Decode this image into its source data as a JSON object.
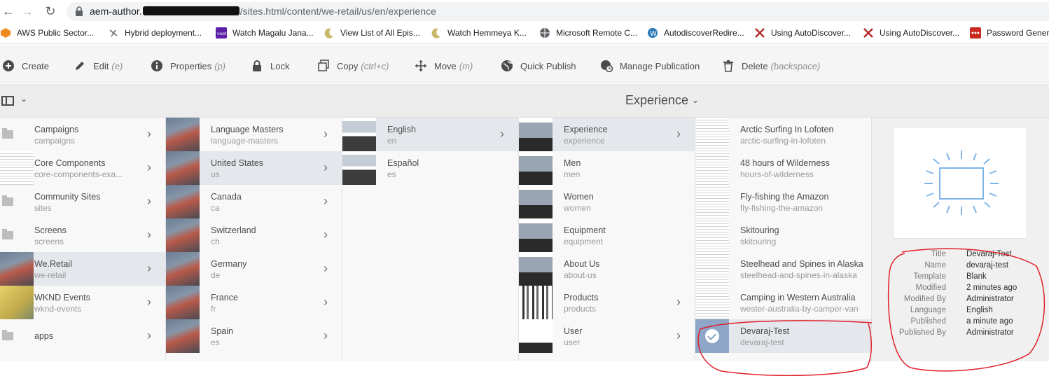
{
  "browser": {
    "url_host": "aem-author.",
    "url_path": "/sites.html/content/we-retail/us/en/experience",
    "bookmarks": [
      {
        "label": "AWS Public Sector...",
        "icon": "aws-icon"
      },
      {
        "label": "Hybrid deployment...",
        "icon": "page-icon"
      },
      {
        "label": "Watch Magalu Jana...",
        "icon": "voot-icon"
      },
      {
        "label": "View List of All Epis...",
        "icon": "moon-icon"
      },
      {
        "label": "Watch Hemmeya K...",
        "icon": "moon-icon"
      },
      {
        "label": "Microsoft Remote C...",
        "icon": "globe-icon"
      },
      {
        "label": "AutodiscoverRedire...",
        "icon": "wordpress-icon"
      },
      {
        "label": "Using AutoDiscover...",
        "icon": "x-logo-icon"
      },
      {
        "label": "Using AutoDiscover...",
        "icon": "x-logo-icon"
      },
      {
        "label": "Password Genera",
        "icon": "dots-icon"
      }
    ]
  },
  "actions": {
    "create": "Create",
    "edit": "Edit",
    "edit_sc": "(e)",
    "properties": "Properties",
    "properties_sc": "(p)",
    "lock": "Lock",
    "copy": "Copy",
    "copy_sc": "(ctrl+c)",
    "move": "Move",
    "move_sc": "(m)",
    "quick_publish": "Quick Publish",
    "manage_publication": "Manage Publication",
    "delete": "Delete",
    "delete_sc": "(backspace)"
  },
  "title": "Experience",
  "columns": [
    {
      "items": [
        {
          "label": "Campaigns",
          "name": "campaigns",
          "thumb": "folder",
          "chevron": true
        },
        {
          "label": "Core Components",
          "name": "core-components-exa...",
          "thumb": "page",
          "chevron": true
        },
        {
          "label": "Community Sites",
          "name": "sites",
          "thumb": "folder",
          "chevron": true
        },
        {
          "label": "Screens",
          "name": "screens",
          "thumb": "folder",
          "chevron": true
        },
        {
          "label": "We.Retail",
          "name": "we-retail",
          "thumb": "rock",
          "chevron": true,
          "selected": true
        },
        {
          "label": "WKND Events",
          "name": "wknd-events",
          "thumb": "yellow",
          "chevron": true
        },
        {
          "label": "apps",
          "name": "",
          "thumb": "folder",
          "chevron": true
        }
      ]
    },
    {
      "items": [
        {
          "label": "Language Masters",
          "name": "language-masters",
          "thumb": "rock",
          "chevron": true
        },
        {
          "label": "United States",
          "name": "us",
          "thumb": "rock",
          "chevron": true,
          "selected": true
        },
        {
          "label": "Canada",
          "name": "ca",
          "thumb": "rock",
          "chevron": true
        },
        {
          "label": "Switzerland",
          "name": "ch",
          "thumb": "rock",
          "chevron": true
        },
        {
          "label": "Germany",
          "name": "de",
          "thumb": "rock",
          "chevron": true
        },
        {
          "label": "France",
          "name": "fr",
          "thumb": "rock",
          "chevron": true
        },
        {
          "label": "Spain",
          "name": "es",
          "thumb": "rock",
          "chevron": true
        }
      ]
    },
    {
      "items": [
        {
          "label": "English",
          "name": "en",
          "thumb": "site",
          "chevron": true,
          "selected": true
        },
        {
          "label": "Español",
          "name": "es",
          "thumb": "site",
          "chevron": false
        }
      ]
    },
    {
      "items": [
        {
          "label": "Experience",
          "name": "experience",
          "thumb": "dark",
          "chevron": true,
          "selected": true
        },
        {
          "label": "Men",
          "name": "men",
          "thumb": "dark",
          "chevron": false
        },
        {
          "label": "Women",
          "name": "women",
          "thumb": "dark",
          "chevron": false
        },
        {
          "label": "Equipment",
          "name": "equipment",
          "thumb": "dark",
          "chevron": false
        },
        {
          "label": "About Us",
          "name": "about-us",
          "thumb": "dark",
          "chevron": false
        },
        {
          "label": "Products",
          "name": "products",
          "thumb": "prod",
          "chevron": true
        },
        {
          "label": "User",
          "name": "user",
          "thumb": "user",
          "chevron": true
        }
      ]
    },
    {
      "items": [
        {
          "label": "Arctic Surfing In Lofoten",
          "name": "arctic-surfing-in-lofoten",
          "thumb": "page",
          "chevron": false
        },
        {
          "label": "48 hours of Wilderness",
          "name": "hours-of-wilderness",
          "thumb": "page",
          "chevron": false
        },
        {
          "label": "Fly-fishing the Amazon",
          "name": "fly-fishing-the-amazon",
          "thumb": "page",
          "chevron": false
        },
        {
          "label": "Skitouring",
          "name": "skitouring",
          "thumb": "page",
          "chevron": false
        },
        {
          "label": "Steelhead and Spines in Alaska",
          "name": "steelhead-and-spines-in-alaska",
          "thumb": "page",
          "chevron": false
        },
        {
          "label": "Camping in Western Australia",
          "name": "wester-australia-by-camper-van",
          "thumb": "page",
          "chevron": false
        },
        {
          "label": "Devaraj-Test",
          "name": "devaraj-test",
          "thumb": "checked",
          "chevron": false,
          "selected": true
        }
      ]
    }
  ],
  "meta": {
    "title_k": "Title",
    "title_v": "Devaraj-Test",
    "name_k": "Name",
    "name_v": "devaraj-test",
    "template_k": "Template",
    "template_v": "Blank",
    "modified_k": "Modified",
    "modified_v": "2 minutes ago",
    "modifiedby_k": "Modified By",
    "modifiedby_v": "Administrator",
    "language_k": "Language",
    "language_v": "English",
    "published_k": "Published",
    "published_v": "a minute ago",
    "publishedby_k": "Published By",
    "publishedby_v": "Administrator"
  },
  "colors": {
    "selected_row": "#e4e7ec",
    "annotation": "#e0202a",
    "preview_icon": "#7fb5e6"
  }
}
